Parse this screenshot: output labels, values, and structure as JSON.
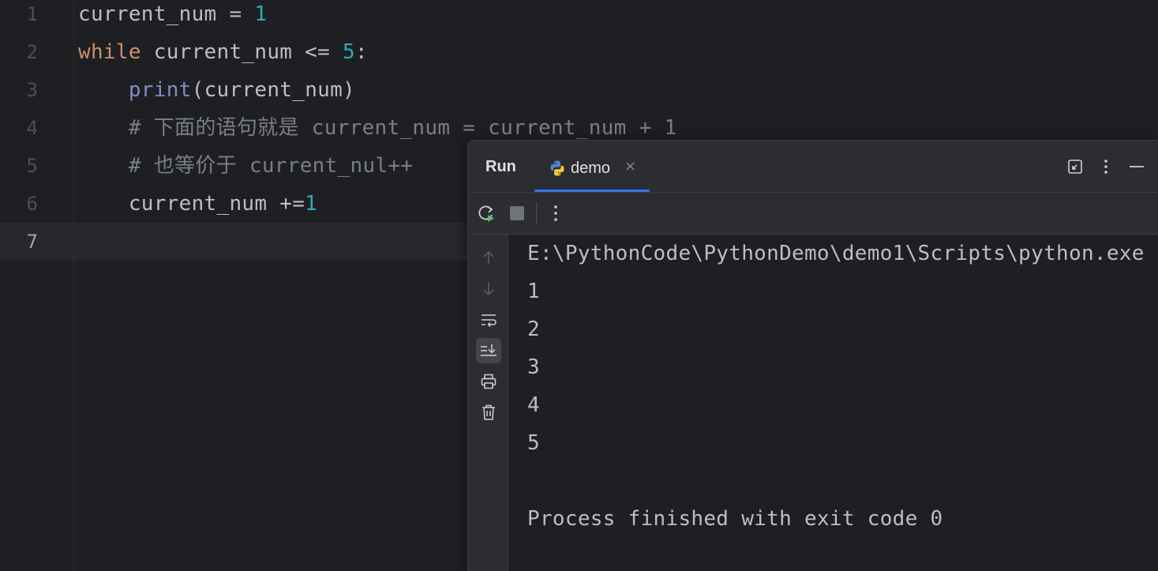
{
  "editor": {
    "line_numbers": [
      "1",
      "2",
      "3",
      "4",
      "5",
      "6",
      "7"
    ],
    "active_line": "7",
    "lines": [
      {
        "tokens": [
          {
            "t": "current_num = ",
            "c": "plain"
          },
          {
            "t": "1",
            "c": "num"
          }
        ]
      },
      {
        "tokens": [
          {
            "t": "while",
            "c": "kw"
          },
          {
            "t": " current_num <= ",
            "c": "plain"
          },
          {
            "t": "5",
            "c": "num"
          },
          {
            "t": ":",
            "c": "plain"
          }
        ]
      },
      {
        "tokens": [
          {
            "t": "    ",
            "c": "plain"
          },
          {
            "t": "print",
            "c": "builtin"
          },
          {
            "t": "(current_num)",
            "c": "plain"
          }
        ]
      },
      {
        "tokens": [
          {
            "t": "    ",
            "c": "plain"
          },
          {
            "t": "# 下面的语句就是 current_num = current_num + 1",
            "c": "cmt"
          }
        ]
      },
      {
        "tokens": [
          {
            "t": "    ",
            "c": "plain"
          },
          {
            "t": "# 也等价于 current_nul++",
            "c": "cmt"
          }
        ]
      },
      {
        "tokens": [
          {
            "t": "    current_num +=",
            "c": "plain"
          },
          {
            "t": "1",
            "c": "num"
          }
        ]
      },
      {
        "tokens": []
      }
    ],
    "colors": {
      "plain": "#bcbec4",
      "kw": "#cf8e6d",
      "num": "#2aacb8",
      "builtin": "#8888c6",
      "cmt": "#7a7e85"
    }
  },
  "run_panel": {
    "title": "Run",
    "tab_label": "demo",
    "tab_icon": "python-icon",
    "tab_close": "×",
    "header_actions": [
      "restore-layout-icon",
      "more-options-icon",
      "minimize-icon"
    ],
    "toolbar_actions": [
      "rerun-icon",
      "stop-icon",
      "more-options-icon"
    ],
    "side_actions": [
      "scroll-up-icon",
      "scroll-down-icon",
      "soft-wrap-icon",
      "scroll-to-end-icon",
      "print-icon",
      "clear-all-icon"
    ],
    "selected_side_action": "scroll-to-end-icon",
    "accent_color": "#3574f0",
    "console_lines": [
      "E:\\PythonCode\\PythonDemo\\demo1\\Scripts\\python.exe",
      "1",
      "2",
      "3",
      "4",
      "5",
      "",
      "Process finished with exit code 0"
    ]
  }
}
